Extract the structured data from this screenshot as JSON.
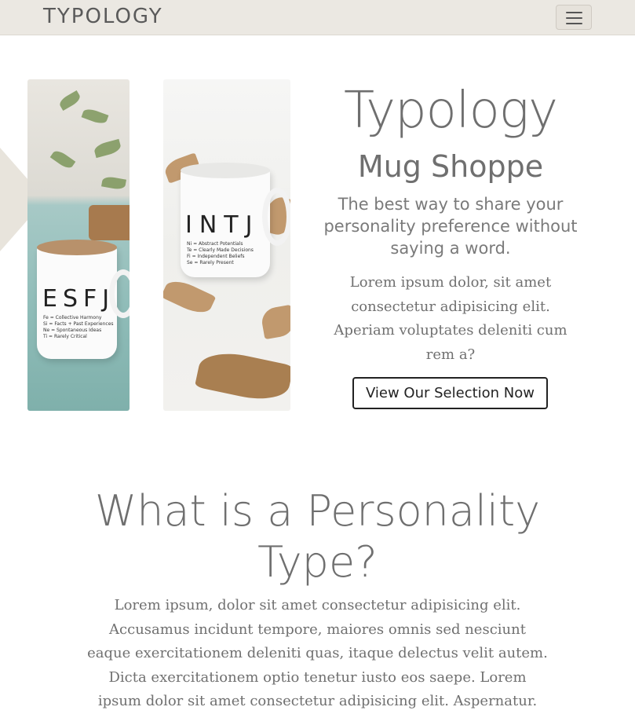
{
  "navbar": {
    "brand": "TYPOLOGY",
    "toggle_icon": "hamburger-menu-icon",
    "background": "#ebe8e2"
  },
  "hero": {
    "title": "Typology",
    "subtitle": "Mug Shoppe",
    "tagline": "The best way to share your personality preference without saying a word.",
    "body": "Lorem ipsum dolor, sit amet consectetur adipisicing elit. Aperiam voluptates deleniti cum rem a?",
    "cta_label": "View Our Selection Now",
    "images": [
      {
        "code": "ESFJ",
        "lines": [
          "Fe = Collective Harmony",
          "Si = Facts + Past Experiences",
          "Ne = Spontaneous Ideas",
          "Ti = Rarely Critical"
        ]
      },
      {
        "code": "INTJ",
        "lines": [
          "Ni = Abstract Potentials",
          "Te = Clearly Made Decisions",
          "Fi = Independent Beliefs",
          "Se = Rarely Present"
        ]
      }
    ]
  },
  "about": {
    "title": "What is a Personality Type?",
    "body": "Lorem ipsum, dolor sit amet consectetur adipisicing elit. Accusamus incidunt tempore, maiores omnis sed nesciunt eaque exercitationem deleniti quas, itaque delectus velit autem. Dicta exercitationem optio tenetur iusto eos saepe. Lorem ipsum dolor sit amet consectetur adipisicing elit. Aspernatur."
  },
  "colors": {
    "accent_beige": "#e8e4dc",
    "text_gray": "#6f6f6f",
    "button_border": "#222222"
  }
}
